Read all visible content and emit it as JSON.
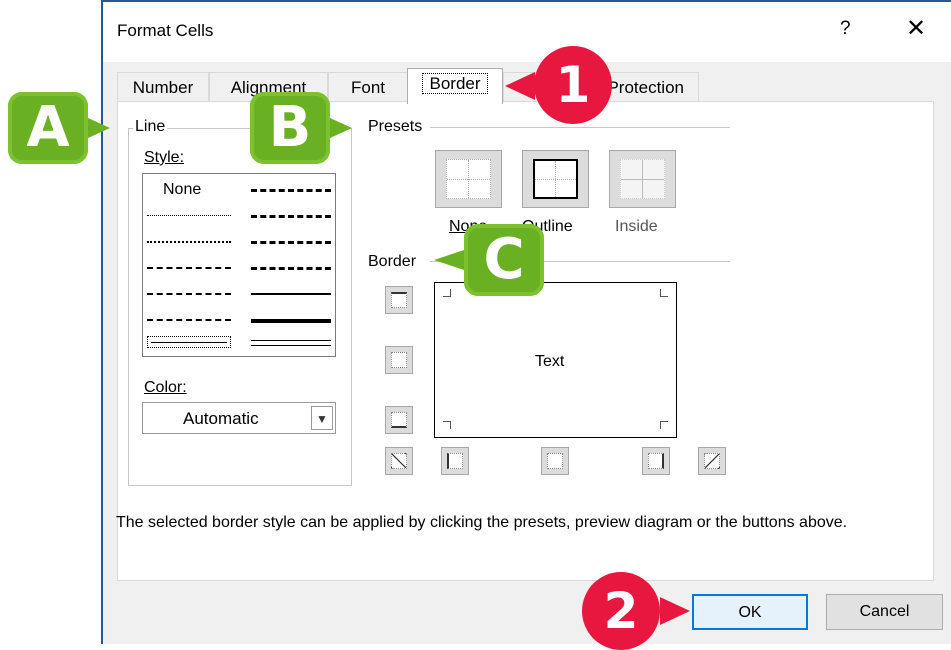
{
  "dialog": {
    "title": "Format Cells",
    "help": "?",
    "close": "✕"
  },
  "tabs": [
    "Number",
    "Alignment",
    "Font",
    "Border",
    "Protection"
  ],
  "active_tab": "Border",
  "line": {
    "group": "Line",
    "style_label": "Style:",
    "style_none": "None",
    "color_label": "Color:",
    "color_value": "Automatic"
  },
  "presets": {
    "group": "Presets",
    "items": [
      "None",
      "Outline",
      "Inside"
    ]
  },
  "border": {
    "group": "Border",
    "preview_text": "Text"
  },
  "description": "The selected border style can be applied by clicking the presets, preview diagram or the buttons above.",
  "buttons": {
    "ok": "OK",
    "cancel": "Cancel"
  },
  "callouts": {
    "a": "A",
    "b": "B",
    "c": "C",
    "one": "1",
    "two": "2"
  },
  "colors": {
    "accent": "#0078d7",
    "callout_green": "#6ab023",
    "callout_red": "#e8173f"
  }
}
